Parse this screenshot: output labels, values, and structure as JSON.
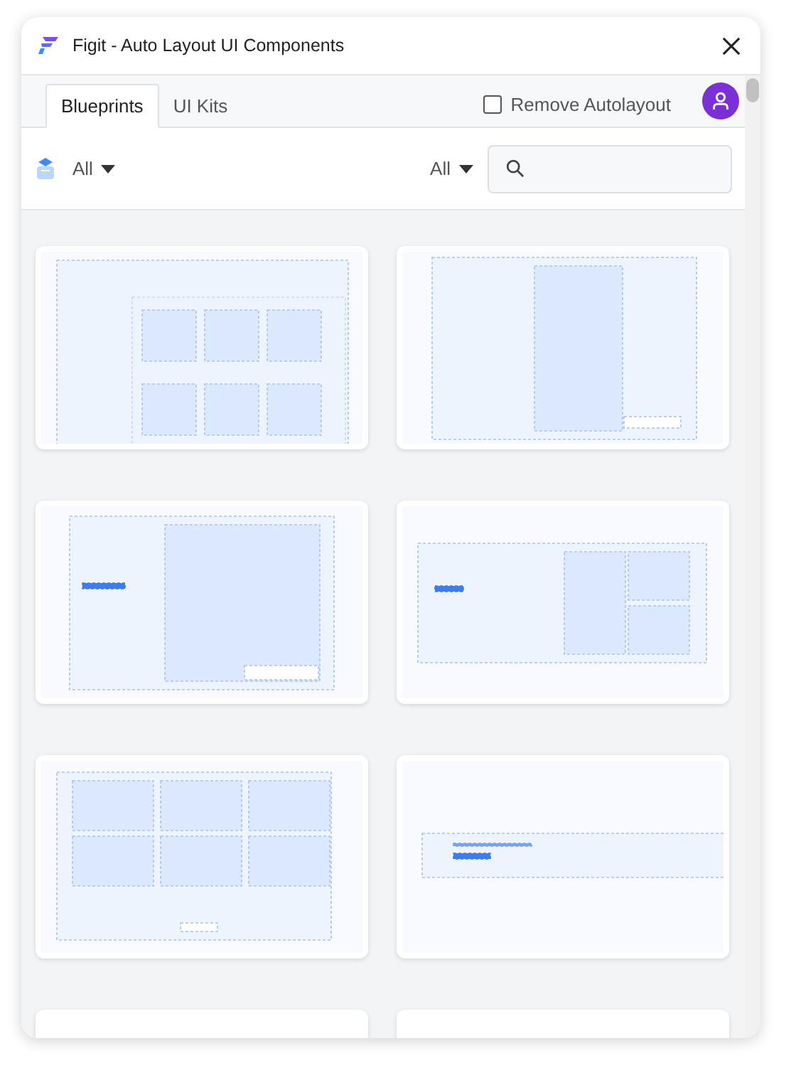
{
  "window": {
    "title": "Figit - Auto Layout UI Components"
  },
  "tabs": [
    {
      "label": "Blueprints",
      "selected": true
    },
    {
      "label": "UI Kits",
      "selected": false
    }
  ],
  "remove_autolayout": {
    "label": "Remove Autolayout",
    "checked": false
  },
  "filters": [
    {
      "label": "All"
    },
    {
      "label": "All"
    }
  ],
  "cards": [
    {
      "kind": "page-grid"
    },
    {
      "kind": "split-tall"
    },
    {
      "kind": "split-left"
    },
    {
      "kind": "hero-gallery"
    },
    {
      "kind": "gallery-grid"
    },
    {
      "kind": "banner"
    },
    {
      "kind": "cut"
    },
    {
      "kind": "cut"
    }
  ]
}
